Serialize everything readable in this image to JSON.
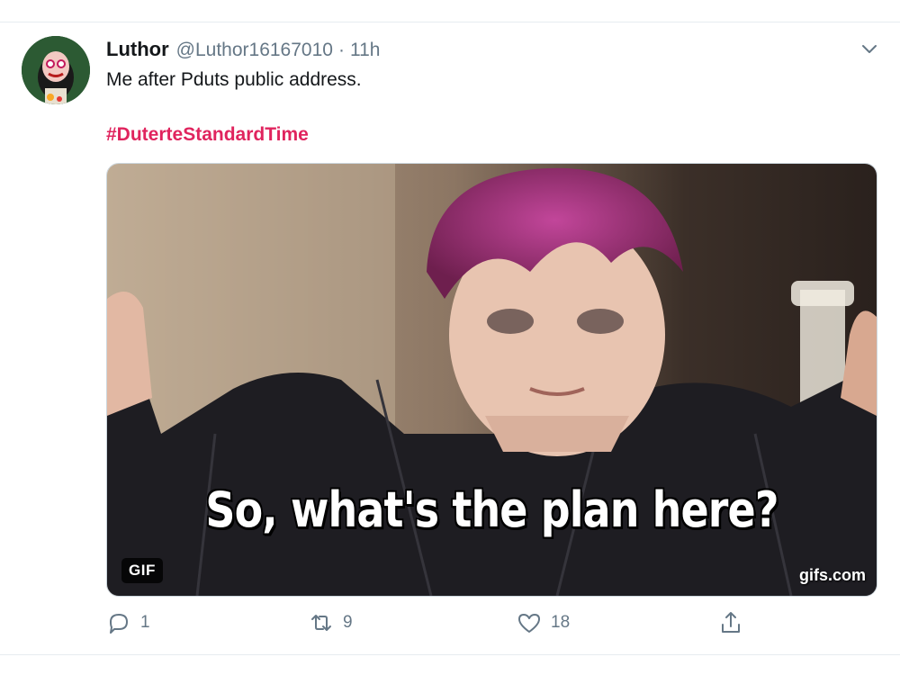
{
  "tweet": {
    "author_name": "Luthor",
    "handle": "@Luthor16167010",
    "separator": "·",
    "time": "11h",
    "text": "Me after Pduts public address.",
    "hashtag": "#DuterteStandardTime"
  },
  "media": {
    "caption": "So, what's the plan here?",
    "badge": "GIF",
    "watermark": "gifs.com"
  },
  "actions": {
    "reply_count": "1",
    "retweet_count": "9",
    "like_count": "18"
  },
  "icons": {
    "caret": "chevron-down-icon",
    "reply": "reply-icon",
    "retweet": "retweet-icon",
    "like": "heart-icon",
    "share": "share-icon"
  },
  "colors": {
    "hashtag": "#e0245e",
    "muted": "#657786",
    "text": "#14171a"
  }
}
